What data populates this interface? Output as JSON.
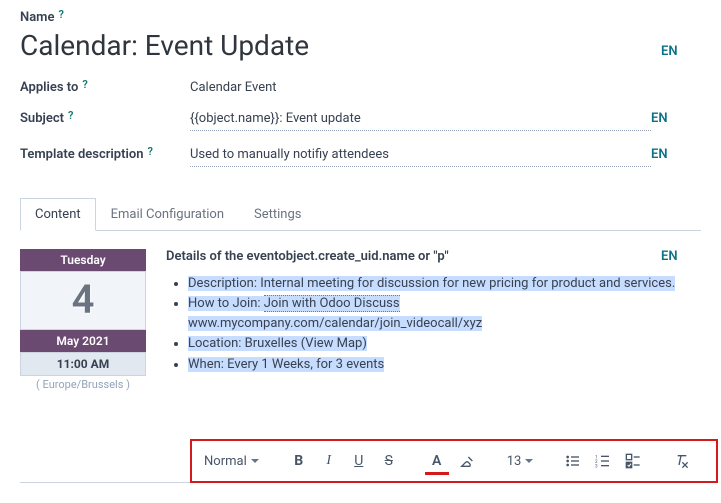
{
  "header": {
    "name_label": "Name",
    "title": "Calendar: Event Update",
    "lang_badge": "EN"
  },
  "fields": {
    "applies_to_label": "Applies to",
    "applies_to_value": "Calendar Event",
    "subject_label": "Subject",
    "subject_value": "{{object.name}}: Event update",
    "template_desc_label": "Template description",
    "template_desc_value": "Used to manually notifiy attendees"
  },
  "tabs": {
    "content": "Content",
    "email_config": "Email Configuration",
    "settings": "Settings"
  },
  "calendar": {
    "weekday": "Tuesday",
    "day": "4",
    "monthyear": "May 2021",
    "time": "11:00 AM",
    "tz": "( Europe/Brussels )"
  },
  "details": {
    "heading": "Details of the eventobject.create_uid.name or \"p\"",
    "desc_label": "Description: ",
    "desc_body": "Internal meeting for discussion for new pricing for product and services.",
    "how_label": "How to Join: ",
    "how_link": "Join with Odoo Discuss",
    "how_url": "www.mycompany.com/calendar/join_videocall/xyz",
    "location": "Location: Bruxelles (View Map)",
    "when": "When: Every 1 Weeks, for 3 events"
  },
  "toolbar": {
    "style": "Normal",
    "size": "13"
  },
  "lang": "EN"
}
